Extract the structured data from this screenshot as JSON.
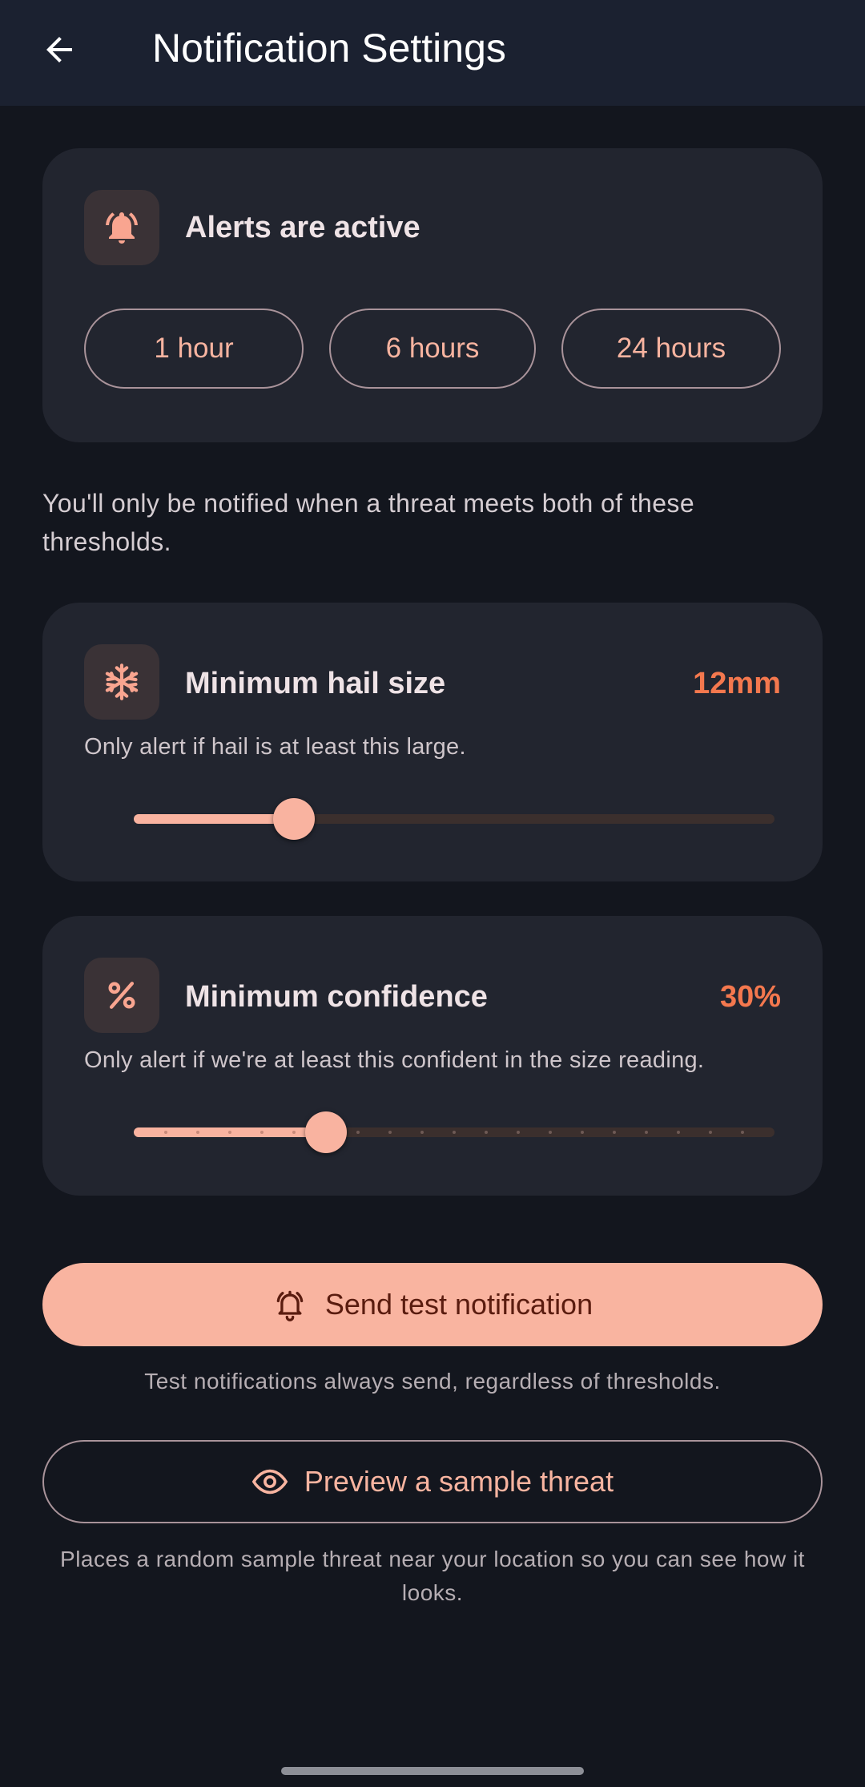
{
  "appbar": {
    "title": "Notification Settings",
    "back_icon": "arrow-left-icon"
  },
  "alerts_card": {
    "icon": "bell-ringing-icon",
    "status": "Alerts are active",
    "durations": [
      "1 hour",
      "6 hours",
      "24 hours"
    ]
  },
  "intro_text": "You'll only be notified when a threat meets both of these thresholds.",
  "hail_card": {
    "icon": "snowflake-icon",
    "title": "Minimum hail size",
    "value": "12mm",
    "description": "Only alert if hail is at least this large.",
    "slider_fraction": 0.25
  },
  "confidence_card": {
    "icon": "percent-icon",
    "title": "Minimum confidence",
    "value": "30%",
    "description": "Only alert if we're at least this confident in the size reading.",
    "slider_fraction": 0.3,
    "slider_divisions": 20
  },
  "test_button": {
    "icon": "bell-ringing-icon",
    "label": "Send test notification",
    "caption": "Test notifications always send, regardless of thresholds."
  },
  "preview_button": {
    "icon": "eye-icon",
    "label": "Preview a sample threat",
    "caption": "Places a random sample threat near your location so you can see how it looks."
  },
  "colors": {
    "background": "#13161e",
    "appbar": "#1b2130",
    "card": "#22252f",
    "accent": "#f9b4a0",
    "value_accent": "#f4784e",
    "primary_text": "#5a1c0f"
  }
}
